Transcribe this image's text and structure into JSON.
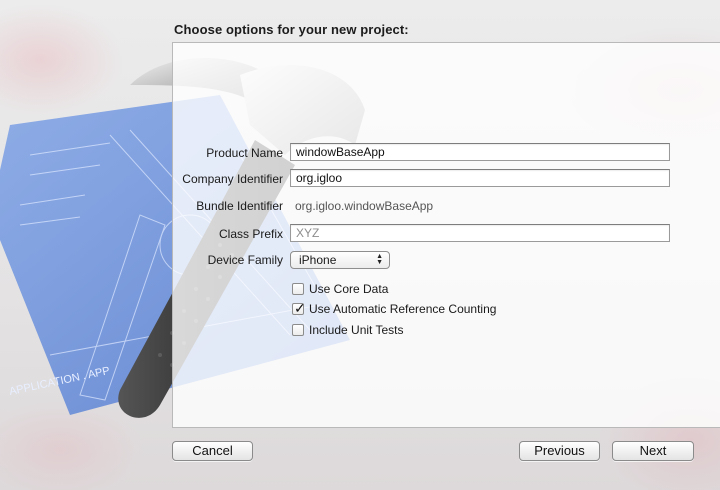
{
  "dialog": {
    "heading": "Choose options for your new project:"
  },
  "form": {
    "product_name": {
      "label": "Product Name",
      "value": "windowBaseApp"
    },
    "company_identifier": {
      "label": "Company Identifier",
      "value": "org.igloo"
    },
    "bundle_identifier": {
      "label": "Bundle Identifier",
      "value": "org.igloo.windowBaseApp"
    },
    "class_prefix": {
      "label": "Class Prefix",
      "placeholder": "XYZ"
    },
    "device_family": {
      "label": "Device Family",
      "selected": "iPhone"
    },
    "options": [
      {
        "label": "Use Core Data",
        "checked": false
      },
      {
        "label": "Use Automatic Reference Counting",
        "checked": true
      },
      {
        "label": "Include Unit Tests",
        "checked": false
      }
    ]
  },
  "buttons": {
    "cancel": "Cancel",
    "previous": "Previous",
    "next": "Next"
  },
  "illustration": {
    "blueprint_text": "APPLICATION . APP",
    "icons": [
      "hammer-icon",
      "blueprint-icon"
    ]
  },
  "colors": {
    "blueprint": "#5e86d6",
    "hammer_grip": "#3a3a3a",
    "panel": "#ffffff"
  }
}
